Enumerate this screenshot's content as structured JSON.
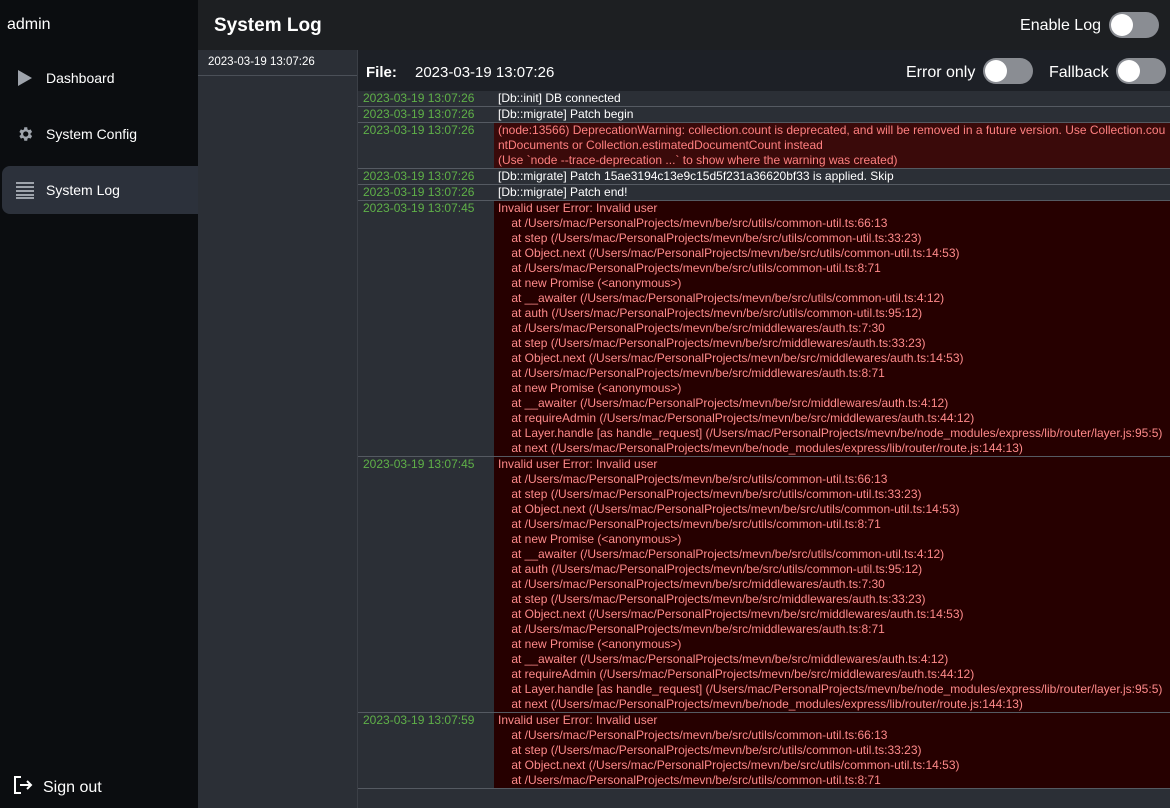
{
  "sidebar": {
    "brand": "admin",
    "items": [
      {
        "label": "Dashboard",
        "icon": "play-icon"
      },
      {
        "label": "System Config",
        "icon": "gear-icon"
      },
      {
        "label": "System Log",
        "icon": "list-icon"
      }
    ],
    "signout": "Sign out"
  },
  "header": {
    "title": "System Log",
    "enable_log_label": "Enable Log"
  },
  "file_list": [
    "2023-03-19 13:07:26"
  ],
  "file_bar": {
    "label": "File:",
    "name": "2023-03-19 13:07:26",
    "error_only_label": "Error only",
    "fallback_label": "Fallback"
  },
  "colors": {
    "timestamp": "#5fb048",
    "error_text": "#ff8a8a",
    "error_bg": "#260000",
    "active_nav": "#2c313b"
  },
  "logs": [
    {
      "time": "2023-03-19 13:07:26",
      "level": "info",
      "text": "[Db::init] DB connected"
    },
    {
      "time": "2023-03-19 13:07:26",
      "level": "info",
      "text": "[Db::migrate] Patch begin"
    },
    {
      "time": "2023-03-19 13:07:26",
      "level": "warn",
      "text": "(node:13566) DeprecationWarning: collection.count is deprecated, and will be removed in a future version. Use Collection.countDocuments or Collection.estimatedDocumentCount instead\n(Use `node --trace-deprecation ...` to show where the warning was created)"
    },
    {
      "time": "2023-03-19 13:07:26",
      "level": "info",
      "text": "[Db::migrate] Patch 15ae3194c13e9c15d5f231a36620bf33 is applied. Skip"
    },
    {
      "time": "2023-03-19 13:07:26",
      "level": "info",
      "text": "[Db::migrate] Patch end!"
    },
    {
      "time": "2023-03-19 13:07:45",
      "level": "err",
      "text": "Invalid user Error: Invalid user\n    at /Users/mac/PersonalProjects/mevn/be/src/utils/common-util.ts:66:13\n    at step (/Users/mac/PersonalProjects/mevn/be/src/utils/common-util.ts:33:23)\n    at Object.next (/Users/mac/PersonalProjects/mevn/be/src/utils/common-util.ts:14:53)\n    at /Users/mac/PersonalProjects/mevn/be/src/utils/common-util.ts:8:71\n    at new Promise (<anonymous>)\n    at __awaiter (/Users/mac/PersonalProjects/mevn/be/src/utils/common-util.ts:4:12)\n    at auth (/Users/mac/PersonalProjects/mevn/be/src/utils/common-util.ts:95:12)\n    at /Users/mac/PersonalProjects/mevn/be/src/middlewares/auth.ts:7:30\n    at step (/Users/mac/PersonalProjects/mevn/be/src/middlewares/auth.ts:33:23)\n    at Object.next (/Users/mac/PersonalProjects/mevn/be/src/middlewares/auth.ts:14:53)\n    at /Users/mac/PersonalProjects/mevn/be/src/middlewares/auth.ts:8:71\n    at new Promise (<anonymous>)\n    at __awaiter (/Users/mac/PersonalProjects/mevn/be/src/middlewares/auth.ts:4:12)\n    at requireAdmin (/Users/mac/PersonalProjects/mevn/be/src/middlewares/auth.ts:44:12)\n    at Layer.handle [as handle_request] (/Users/mac/PersonalProjects/mevn/be/node_modules/express/lib/router/layer.js:95:5)\n    at next (/Users/mac/PersonalProjects/mevn/be/node_modules/express/lib/router/route.js:144:13)"
    },
    {
      "time": "2023-03-19 13:07:45",
      "level": "err",
      "text": "Invalid user Error: Invalid user\n    at /Users/mac/PersonalProjects/mevn/be/src/utils/common-util.ts:66:13\n    at step (/Users/mac/PersonalProjects/mevn/be/src/utils/common-util.ts:33:23)\n    at Object.next (/Users/mac/PersonalProjects/mevn/be/src/utils/common-util.ts:14:53)\n    at /Users/mac/PersonalProjects/mevn/be/src/utils/common-util.ts:8:71\n    at new Promise (<anonymous>)\n    at __awaiter (/Users/mac/PersonalProjects/mevn/be/src/utils/common-util.ts:4:12)\n    at auth (/Users/mac/PersonalProjects/mevn/be/src/utils/common-util.ts:95:12)\n    at /Users/mac/PersonalProjects/mevn/be/src/middlewares/auth.ts:7:30\n    at step (/Users/mac/PersonalProjects/mevn/be/src/middlewares/auth.ts:33:23)\n    at Object.next (/Users/mac/PersonalProjects/mevn/be/src/middlewares/auth.ts:14:53)\n    at /Users/mac/PersonalProjects/mevn/be/src/middlewares/auth.ts:8:71\n    at new Promise (<anonymous>)\n    at __awaiter (/Users/mac/PersonalProjects/mevn/be/src/middlewares/auth.ts:4:12)\n    at requireAdmin (/Users/mac/PersonalProjects/mevn/be/src/middlewares/auth.ts:44:12)\n    at Layer.handle [as handle_request] (/Users/mac/PersonalProjects/mevn/be/node_modules/express/lib/router/layer.js:95:5)\n    at next (/Users/mac/PersonalProjects/mevn/be/node_modules/express/lib/router/route.js:144:13)"
    },
    {
      "time": "2023-03-19 13:07:59",
      "level": "err",
      "text": "Invalid user Error: Invalid user\n    at /Users/mac/PersonalProjects/mevn/be/src/utils/common-util.ts:66:13\n    at step (/Users/mac/PersonalProjects/mevn/be/src/utils/common-util.ts:33:23)\n    at Object.next (/Users/mac/PersonalProjects/mevn/be/src/utils/common-util.ts:14:53)\n    at /Users/mac/PersonalProjects/mevn/be/src/utils/common-util.ts:8:71"
    }
  ]
}
